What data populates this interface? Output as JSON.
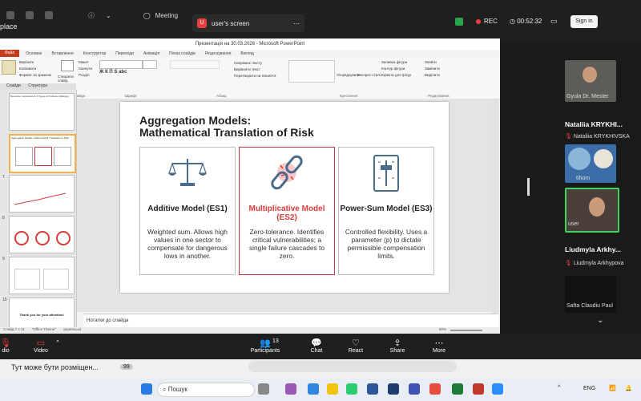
{
  "zoom": {
    "meeting_tab": "Meeting",
    "left_partial": "place",
    "share_label": "user's screen",
    "rec_label": "REC",
    "timer": "00:52:32",
    "signin": "Sign in",
    "bottom": {
      "audio": "dio",
      "video": "Video",
      "participants": "Participants",
      "participants_count": "13",
      "chat": "Chat",
      "react": "React",
      "share": "Share",
      "more": "More"
    }
  },
  "ppt": {
    "window_title": "Презентація на 30.03.2026 - Microsoft PowerPoint",
    "tabs": [
      "Файл",
      "Основне",
      "Вставлення",
      "Конструктор",
      "Переходи",
      "Анімація",
      "Показ слайдів",
      "Рецензування",
      "Вигляд"
    ],
    "ribbon_groups": [
      "Буфер обміну",
      "Слайди",
      "Шрифт",
      "Абзац",
      "Креслення",
      "Редагування"
    ],
    "ribbon_buttons": [
      "Вирізати",
      "Копіювати",
      "Формат за зразком",
      "Створити слайд",
      "Макет",
      "Скинути",
      "Розділ",
      "Упорядкувати",
      "Експрес-стилі",
      "Заливка фігури",
      "Контур фігури",
      "Ефекти для фігур",
      "Знайти",
      "Замінити",
      "Виділити",
      "Напрямок тексту",
      "Вирівняти текст",
      "Перетворити на SmartArt"
    ],
    "panel_tabs": [
      "Слайди",
      "Структура"
    ],
    "thumbnail_numbers": [
      "",
      "6",
      "7",
      "8",
      "9",
      "10",
      "11"
    ],
    "thumb_texts": {
      "t1": "Resource Constraints & 3 Types of Problems (Ratings)",
      "t2": "Aggregation Models: Mathematical Translation of Risk",
      "t6": "Thank you for your attention!"
    },
    "notes_placeholder": "Нотатки до слайда",
    "status_left": "Слайд 7 з 11",
    "status_theme": "\"Office Theme\"",
    "status_lang": "українська",
    "zoom_pct": "80%"
  },
  "slide": {
    "title_line1": "Aggregation Models:",
    "title_line2": "Mathematical Translation of Risk",
    "cards": [
      {
        "title": "Additive Model (ES1)",
        "desc": "Weighted sum. Allows high values in one sector to compensate for dangerous lows in another.",
        "icon": "scale-icon"
      },
      {
        "title": "Multiplicative Model (ES2)",
        "desc": "Zero-tolerance. Identifies critical vulnerabilities; a single failure cascades to zero.",
        "icon": "broken-chain-icon"
      },
      {
        "title": "Power-Sum Model (ES3)",
        "desc": "Controlled flexibility. Uses a parameter (p) to dictate permissible compensation limits.",
        "icon": "slider-icon"
      }
    ]
  },
  "participants": [
    {
      "name": "Gyula Dr. Mester"
    },
    {
      "name_big": "Nataliia KRYKHI...",
      "name": "Nataliia KRYKHIVSKA"
    },
    {
      "name": "tihom"
    },
    {
      "name": "user"
    },
    {
      "name_big": "Liudmyla Arkhy...",
      "name": "Liudmyla Arkhypova"
    },
    {
      "name": "Safta Claudiu Paul"
    }
  ],
  "notification": {
    "text": "Тут може бути розміщен...",
    "badge": "99"
  },
  "taskbar": {
    "search": "Пошук",
    "lang": "ENG"
  },
  "colors": {
    "accent_red": "#d83b3b",
    "ppt_file": "#c43e1c",
    "active_thumb": "#f2b14a"
  }
}
